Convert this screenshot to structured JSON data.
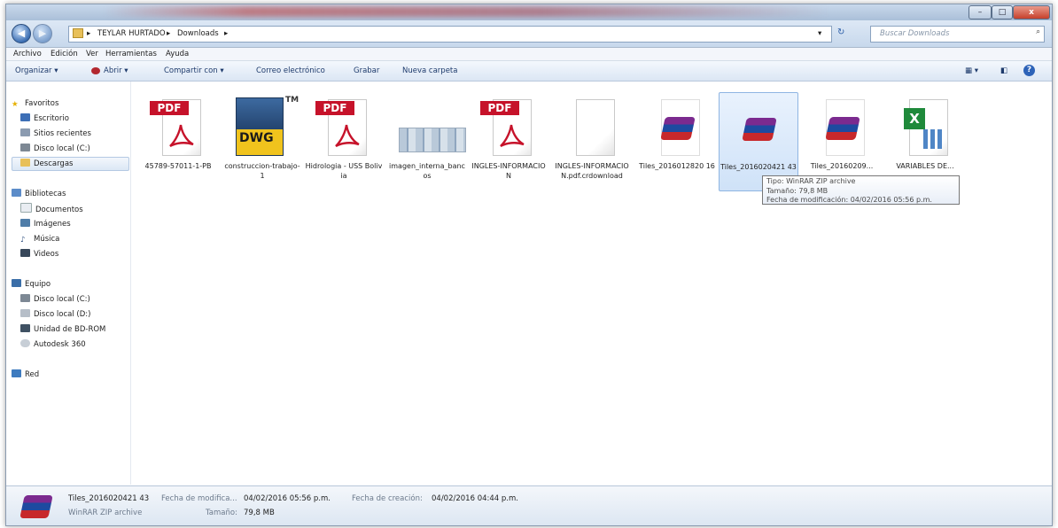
{
  "address": {
    "root_arrow": "▸",
    "segments": [
      "TEYLAR HURTADO",
      "Downloads"
    ],
    "search_placeholder": "Buscar Downloads"
  },
  "menu": [
    "Archivo",
    "Edición",
    "Ver",
    "Herramientas",
    "Ayuda"
  ],
  "toolbar": {
    "organize": "Organizar ▾",
    "open": "Abrir ▾",
    "share": "Compartir con ▾",
    "email": "Correo electrónico",
    "burn": "Grabar",
    "new_folder": "Nueva carpeta"
  },
  "sidebar": {
    "favorites": "Favoritos",
    "fav_items": [
      "Escritorio",
      "Sitios recientes",
      "Disco local (C:)",
      "Descargas"
    ],
    "libraries": "Bibliotecas",
    "lib_items": [
      "Documentos",
      "Imágenes",
      "Música",
      "Videos"
    ],
    "computer": "Equipo",
    "comp_items": [
      "Disco local (C:)",
      "Disco local (D:)",
      "Unidad de BD-ROM",
      "Autodesk 360"
    ],
    "network": "Red"
  },
  "files": [
    {
      "name": "45789-57011-1-PB",
      "type": "pdf"
    },
    {
      "name": "construccion-trabajo-1",
      "type": "dwg"
    },
    {
      "name": "Hidrologia - USS Bolivia",
      "type": "pdf"
    },
    {
      "name": "imagen_interna_bancos",
      "type": "img"
    },
    {
      "name": "INGLES-INFORMACION",
      "type": "pdf"
    },
    {
      "name": "INGLES-INFORMACION.pdf.crdownload",
      "type": "blank"
    },
    {
      "name": "Tiles_2016012820 16",
      "type": "rar"
    },
    {
      "name": "Tiles_2016020421 43",
      "type": "rar"
    },
    {
      "name": "Tiles_20160209...",
      "type": "rar"
    },
    {
      "name": "VARIABLES DE...",
      "type": "xls"
    }
  ],
  "badges": {
    "pdf": "PDF",
    "dwg": "DWG",
    "tm": "TM"
  },
  "tooltip": {
    "type": "Tipo: WinRAR ZIP archive",
    "size": "Tamaño: 79,8 MB",
    "modified": "Fecha de modificación: 04/02/2016 05:56 p.m."
  },
  "status": {
    "name": "Tiles_2016020421 43",
    "kind": "WinRAR ZIP archive",
    "mod_label": "Fecha de modifica...",
    "mod_value": "04/02/2016 05:56 p.m.",
    "size_label": "Tamaño:",
    "size_value": "79,8 MB",
    "created_label": "Fecha de creación:",
    "created_value": "04/02/2016 04:44 p.m."
  },
  "colors": {
    "pdf_red": "#c6122a",
    "dwg_yellow": "#f0c31d",
    "excel_green": "#1f8a3b",
    "selection": "#cfe2f8"
  }
}
